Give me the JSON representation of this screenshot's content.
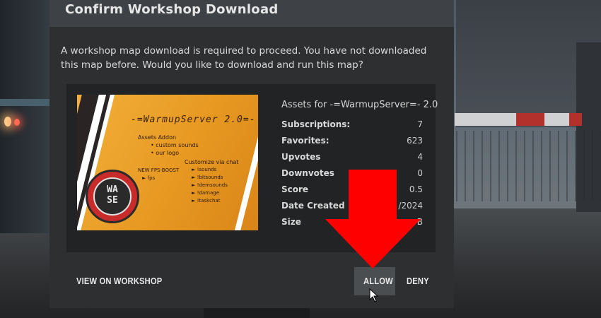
{
  "dialog": {
    "title": "Confirm Workshop Download",
    "message": "A workshop map download is required to proceed. You have not downloaded this map before. Would you like to download and run this map?"
  },
  "thumbnail": {
    "title": "-=WarmupServer 2.0=-",
    "assets_heading": "Assets Addon",
    "assets_items": [
      "• custom sounds",
      "• our logo"
    ],
    "fps_line1": "NEW FPS-BOOST",
    "fps_line2": "► fps",
    "chat_heading": "Customize via chat",
    "chat_items": [
      "► !sounds",
      "► !bitsounds",
      "► !demsounds",
      "► !damage",
      "► !taskchat"
    ],
    "emblem_line1": "WA",
    "emblem_line2": "SE"
  },
  "asset": {
    "title": "Assets for -=WarmupServer=- 2.0",
    "stats": [
      {
        "label": "Subscriptions:",
        "value": "7"
      },
      {
        "label": "Favorites:",
        "value": "623"
      },
      {
        "label": "Upvotes",
        "value": "4"
      },
      {
        "label": "Downvotes",
        "value": "0"
      },
      {
        "label": "Score",
        "value": "0.5"
      },
      {
        "label": "Date Created",
        "value": "/2024"
      },
      {
        "label": "Size",
        "value": "B"
      }
    ]
  },
  "buttons": {
    "view_on_workshop": "VIEW ON WORKSHOP",
    "allow": "ALLOW",
    "deny": "DENY"
  },
  "colors": {
    "dialog_body": "#2d2f31",
    "dialog_header": "#3e4246",
    "arrow": "#ff0000",
    "thumbnail_bg": "#e8a126",
    "emblem": "#c92a2a"
  }
}
